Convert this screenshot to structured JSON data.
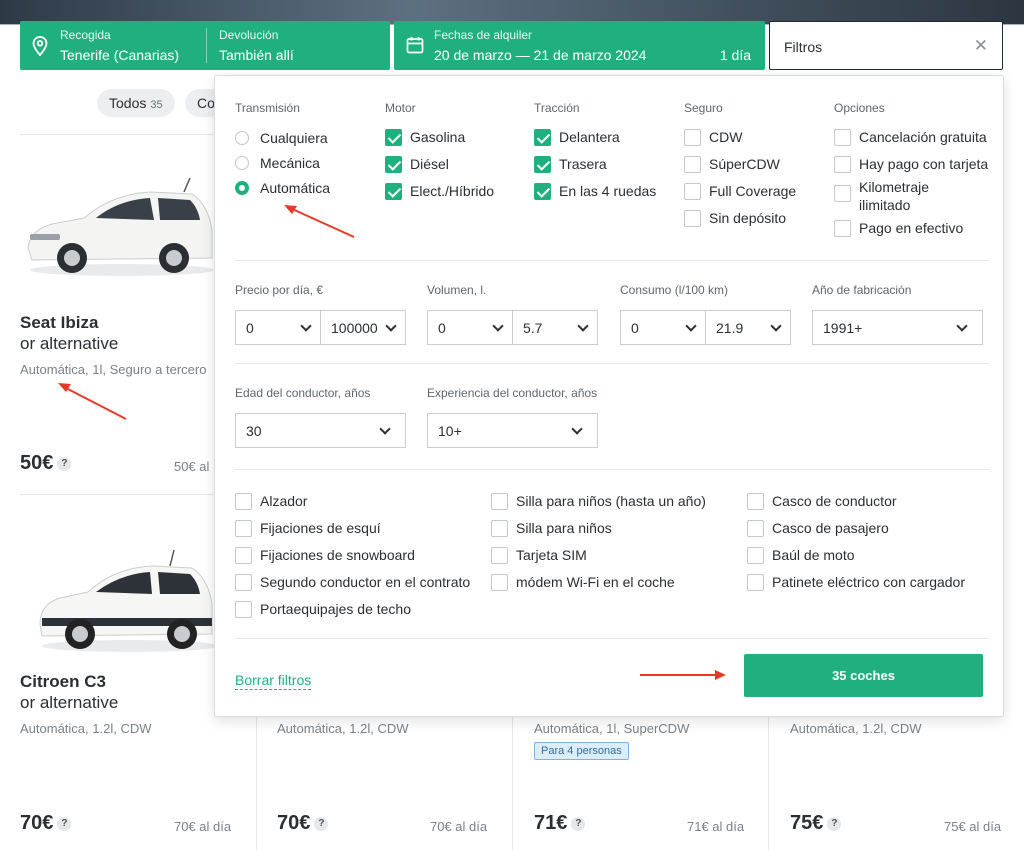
{
  "search": {
    "pickup_label": "Recogida",
    "pickup_value": "Tenerife (Canarias)",
    "return_label": "Devolución",
    "return_value": "También allí",
    "dates_label": "Fechas de alquiler",
    "dates_value": "20 de marzo — 21 de marzo 2024",
    "dates_days": "1 día",
    "filters_label": "Filtros",
    "close_glyph": "✕"
  },
  "chips": [
    {
      "label": "Todos",
      "count": "35"
    },
    {
      "label": "Co"
    }
  ],
  "cars": [
    {
      "name": "Seat Ibiza",
      "alt": "or alternative",
      "spec": "Automática, 1l, Seguro a tercero",
      "price": "50€",
      "perday": "50€ al"
    },
    {
      "name": "Citroen C3",
      "alt": "or alternative",
      "spec": "Automática, 1.2l, CDW",
      "price": "70€",
      "perday": "70€ al día"
    },
    {
      "spec": "Automática, 1.2l, CDW",
      "price": "70€",
      "perday": "70€ al día"
    },
    {
      "spec": "Automática, 1l, SuperCDW",
      "badge": "Para 4 personas",
      "price": "71€",
      "perday": "71€ al día"
    },
    {
      "spec": "Automática, 1.2l, CDW",
      "price": "75€",
      "perday": "75€ al día"
    }
  ],
  "filters": {
    "transmission": {
      "title": "Transmisión",
      "options": [
        {
          "label": "Cualquiera",
          "selected": false
        },
        {
          "label": "Mecánica",
          "selected": false
        },
        {
          "label": "Automática",
          "selected": true
        }
      ]
    },
    "engine": {
      "title": "Motor",
      "options": [
        {
          "label": "Gasolina",
          "checked": true
        },
        {
          "label": "Diésel",
          "checked": true
        },
        {
          "label": "Elect./Híbrido",
          "checked": true
        }
      ]
    },
    "traction": {
      "title": "Tracción",
      "options": [
        {
          "label": "Delantera",
          "checked": true
        },
        {
          "label": "Trasera",
          "checked": true
        },
        {
          "label": "En las 4 ruedas",
          "checked": true
        }
      ]
    },
    "insurance": {
      "title": "Seguro",
      "options": [
        {
          "label": "CDW",
          "checked": false
        },
        {
          "label": "SúperCDW",
          "checked": false
        },
        {
          "label": "Full Coverage",
          "checked": false
        },
        {
          "label": "Sin depósito",
          "checked": false
        }
      ]
    },
    "options": {
      "title": "Opciones",
      "options": [
        {
          "label": "Cancelación gratuita",
          "checked": false
        },
        {
          "label": "Hay pago con tarjeta",
          "checked": false
        },
        {
          "label": "Kilometraje",
          "label2": "ilimitado",
          "checked": false
        },
        {
          "label": "Pago en efectivo",
          "checked": false
        }
      ]
    },
    "price": {
      "title": "Precio por día, €",
      "from": "0",
      "to": "100000"
    },
    "volume": {
      "title": "Volumen, l.",
      "from": "0",
      "to": "5.7"
    },
    "consumption": {
      "title": "Consumo (l/100 km)",
      "from": "0",
      "to": "21.9"
    },
    "year": {
      "title": "Año de fabricación",
      "value": "1991+"
    },
    "driver_age": {
      "title": "Edad del conductor, años",
      "value": "30"
    },
    "driver_exp": {
      "title": "Experiencia del conductor, años",
      "value": "10+"
    },
    "extras": [
      {
        "label": "Alzador",
        "checked": false
      },
      {
        "label": "Fijaciones de esquí",
        "checked": false
      },
      {
        "label": "Fijaciones de snowboard",
        "checked": false
      },
      {
        "label": "Segundo conductor en el contrato",
        "checked": false
      },
      {
        "label": "Portaequipajes de techo",
        "checked": false
      },
      {
        "label": "Silla para niños (hasta un año)",
        "checked": false
      },
      {
        "label": "Silla para niños",
        "checked": false
      },
      {
        "label": "Tarjeta SIM",
        "checked": false
      },
      {
        "label": "módem Wi-Fi en el coche",
        "checked": false
      },
      {
        "label": "Casco de conductor",
        "checked": false
      },
      {
        "label": "Casco de pasajero",
        "checked": false
      },
      {
        "label": "Baúl de moto",
        "checked": false
      },
      {
        "label": "Patinete eléctrico con cargador",
        "checked": false
      }
    ],
    "clear_label": "Borrar filtros",
    "apply_label": "35 coches"
  },
  "colors": {
    "accent": "#20b07f",
    "annotation_arrow": "#e53a2a"
  },
  "qmark": "?"
}
